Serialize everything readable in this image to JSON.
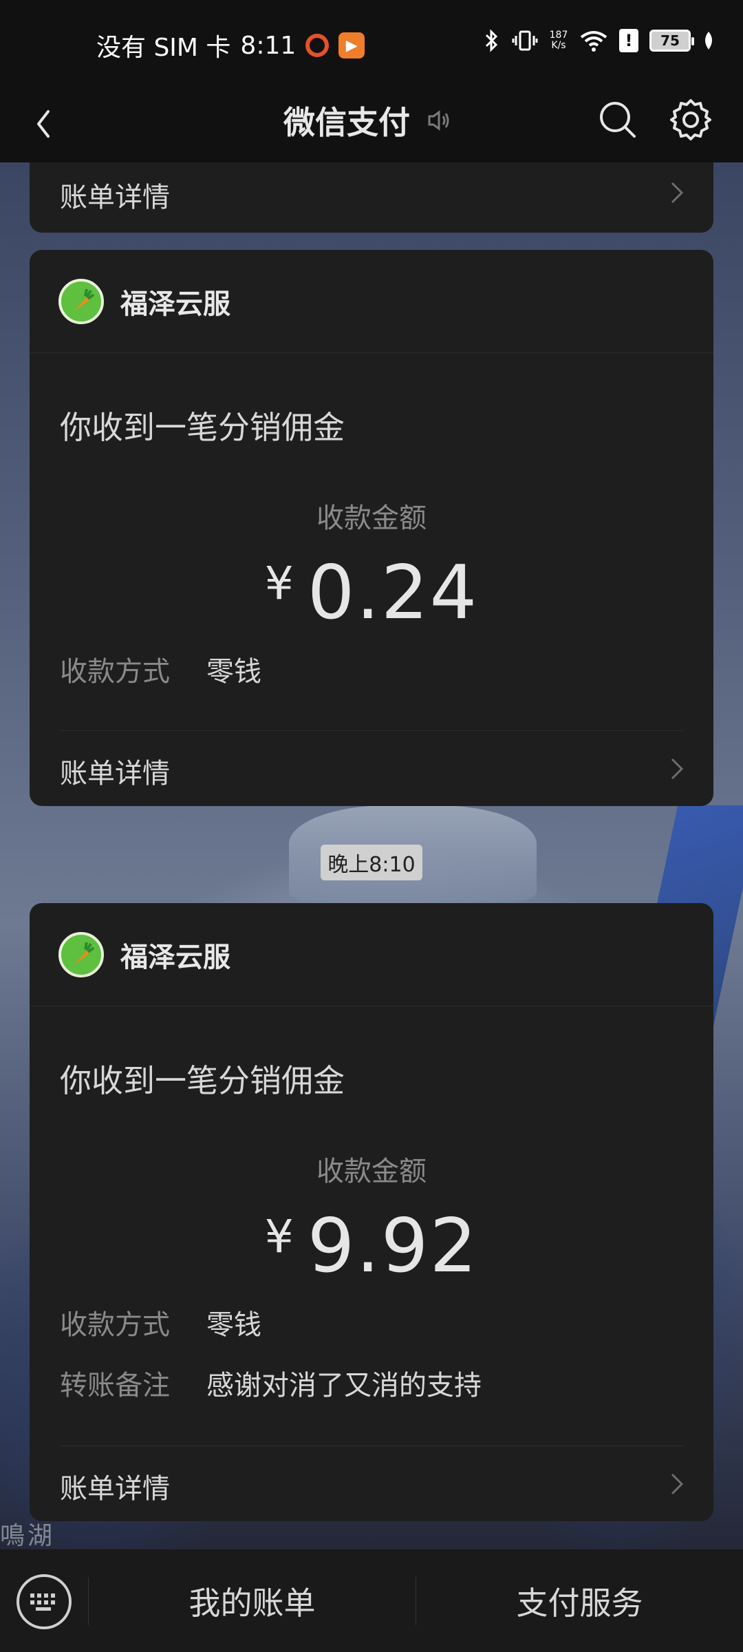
{
  "status_bar": {
    "carrier": "没有 SIM 卡",
    "time": "8:11",
    "net_speed_top": "187",
    "net_speed_bottom": "K/s",
    "battery": "75",
    "warn": "!"
  },
  "header": {
    "title": "微信支付"
  },
  "top_partial_card": {
    "detail_label": "账单详情"
  },
  "cards": [
    {
      "merchant": "福泽云服",
      "title": "你收到一笔分销佣金",
      "amount_label": "收款金额",
      "currency": "¥",
      "amount": "0.24",
      "method_label": "收款方式",
      "method_value": "零钱",
      "detail_label": "账单详情"
    },
    {
      "merchant": "福泽云服",
      "title": "你收到一笔分销佣金",
      "amount_label": "收款金额",
      "currency": "¥",
      "amount": "9.92",
      "method_label": "收款方式",
      "method_value": "零钱",
      "remark_label": "转账备注",
      "remark_value": "感谢对消了又消的支持",
      "detail_label": "账单详情"
    }
  ],
  "time_separator": "晚上8:10",
  "background_text": "鳴湖",
  "bottom_bar": {
    "tab_bills": "我的账单",
    "tab_services": "支付服务"
  },
  "colors": {
    "card_bg": "#1e1e1e",
    "page_bg": "#111111",
    "text_primary": "#d8d8d8",
    "text_secondary": "#8a8a8a",
    "avatar_green": "#5fbf3f"
  },
  "icons": [
    "back-arrow-icon",
    "mute-icon",
    "search-icon",
    "gear-icon",
    "chevron-right-icon",
    "keyboard-icon",
    "carrot-avatar-icon"
  ]
}
